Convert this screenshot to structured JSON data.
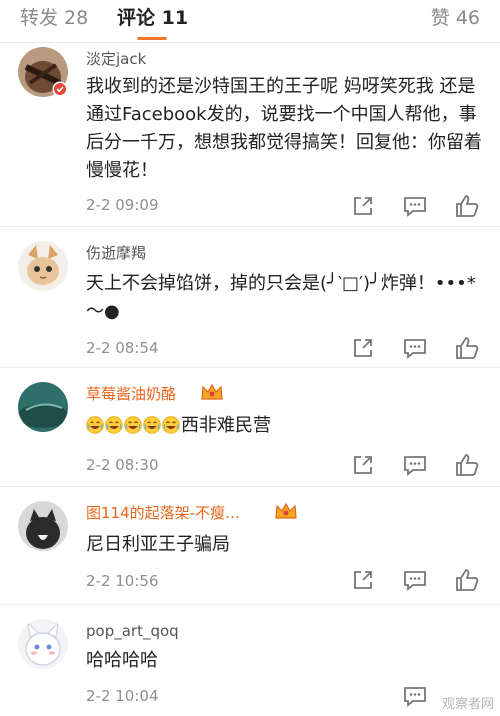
{
  "tabs": {
    "repost": "转发 28",
    "comment": "评论 11",
    "like": "赞 46"
  },
  "comments": [
    {
      "user": "淡定jack",
      "text": "我收到的还是沙特国王的王子呢 妈呀笑死我 还是通过Facebook发的，说要找一个中国人帮他，事后分一千万，想想我都觉得搞笑！回复他：你留着慢慢花！",
      "time": "2-2 09:09"
    },
    {
      "user": "伤逝摩羯",
      "text": "天上不会掉馅饼，掉的只会是(╯‵□′)╯炸弹！•••*～●",
      "time": "2-2 08:54"
    },
    {
      "user": "草莓酱油奶酪",
      "emoji_count": 5,
      "text": "西非难民营",
      "time": "2-2 08:30"
    },
    {
      "user": "图114的起落架-不瘦…",
      "text": "尼日利亚王子骗局",
      "time": "2-2 10:56"
    },
    {
      "user": "pop_art_qoq",
      "text": "哈哈哈哈",
      "time": "2-2 10:04"
    }
  ],
  "icons": {
    "share": "share-icon",
    "reply": "comment-icon",
    "like": "thumbs-up-icon",
    "crown": "vip-crown-icon"
  },
  "colors": {
    "accent": "#f07a2a",
    "vip_name": "#e8661c",
    "muted": "#8f8f8f"
  },
  "watermark": "观察者网"
}
